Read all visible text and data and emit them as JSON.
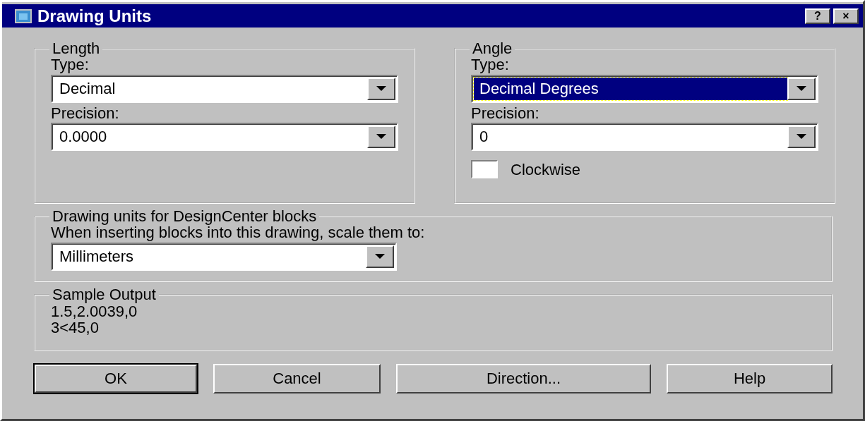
{
  "window": {
    "title": "Drawing Units",
    "buttons": [
      "?",
      "×"
    ]
  },
  "length": {
    "title": "Length",
    "type_label": "Type:",
    "type": {
      "value": "Decimal",
      "selected": false
    },
    "precision_label": "Precision:",
    "precision": {
      "value": "0.0000",
      "selected": false
    }
  },
  "angle": {
    "title": "Angle",
    "type_label": "Type:",
    "type": {
      "value": "Decimal Degrees",
      "selected": true
    },
    "precision_label": "Precision:",
    "precision": {
      "value": "0",
      "selected": false
    },
    "clockwise": {
      "label": "Clockwise",
      "checked": false
    }
  },
  "designcenter": {
    "title": "Drawing units for DesignCenter blocks",
    "prompt": "When inserting blocks into this drawing, scale them to:",
    "units": {
      "value": "Millimeters",
      "selected": false
    }
  },
  "sample_output": {
    "title": "Sample Output",
    "lines": [
      "1.5,2.0039,0",
      "3<45,0"
    ]
  },
  "buttons": [
    {
      "label": "OK",
      "default": true
    },
    {
      "label": "Cancel",
      "default": false
    },
    {
      "label": "Direction...",
      "default": false
    },
    {
      "label": "Help",
      "default": false
    }
  ]
}
